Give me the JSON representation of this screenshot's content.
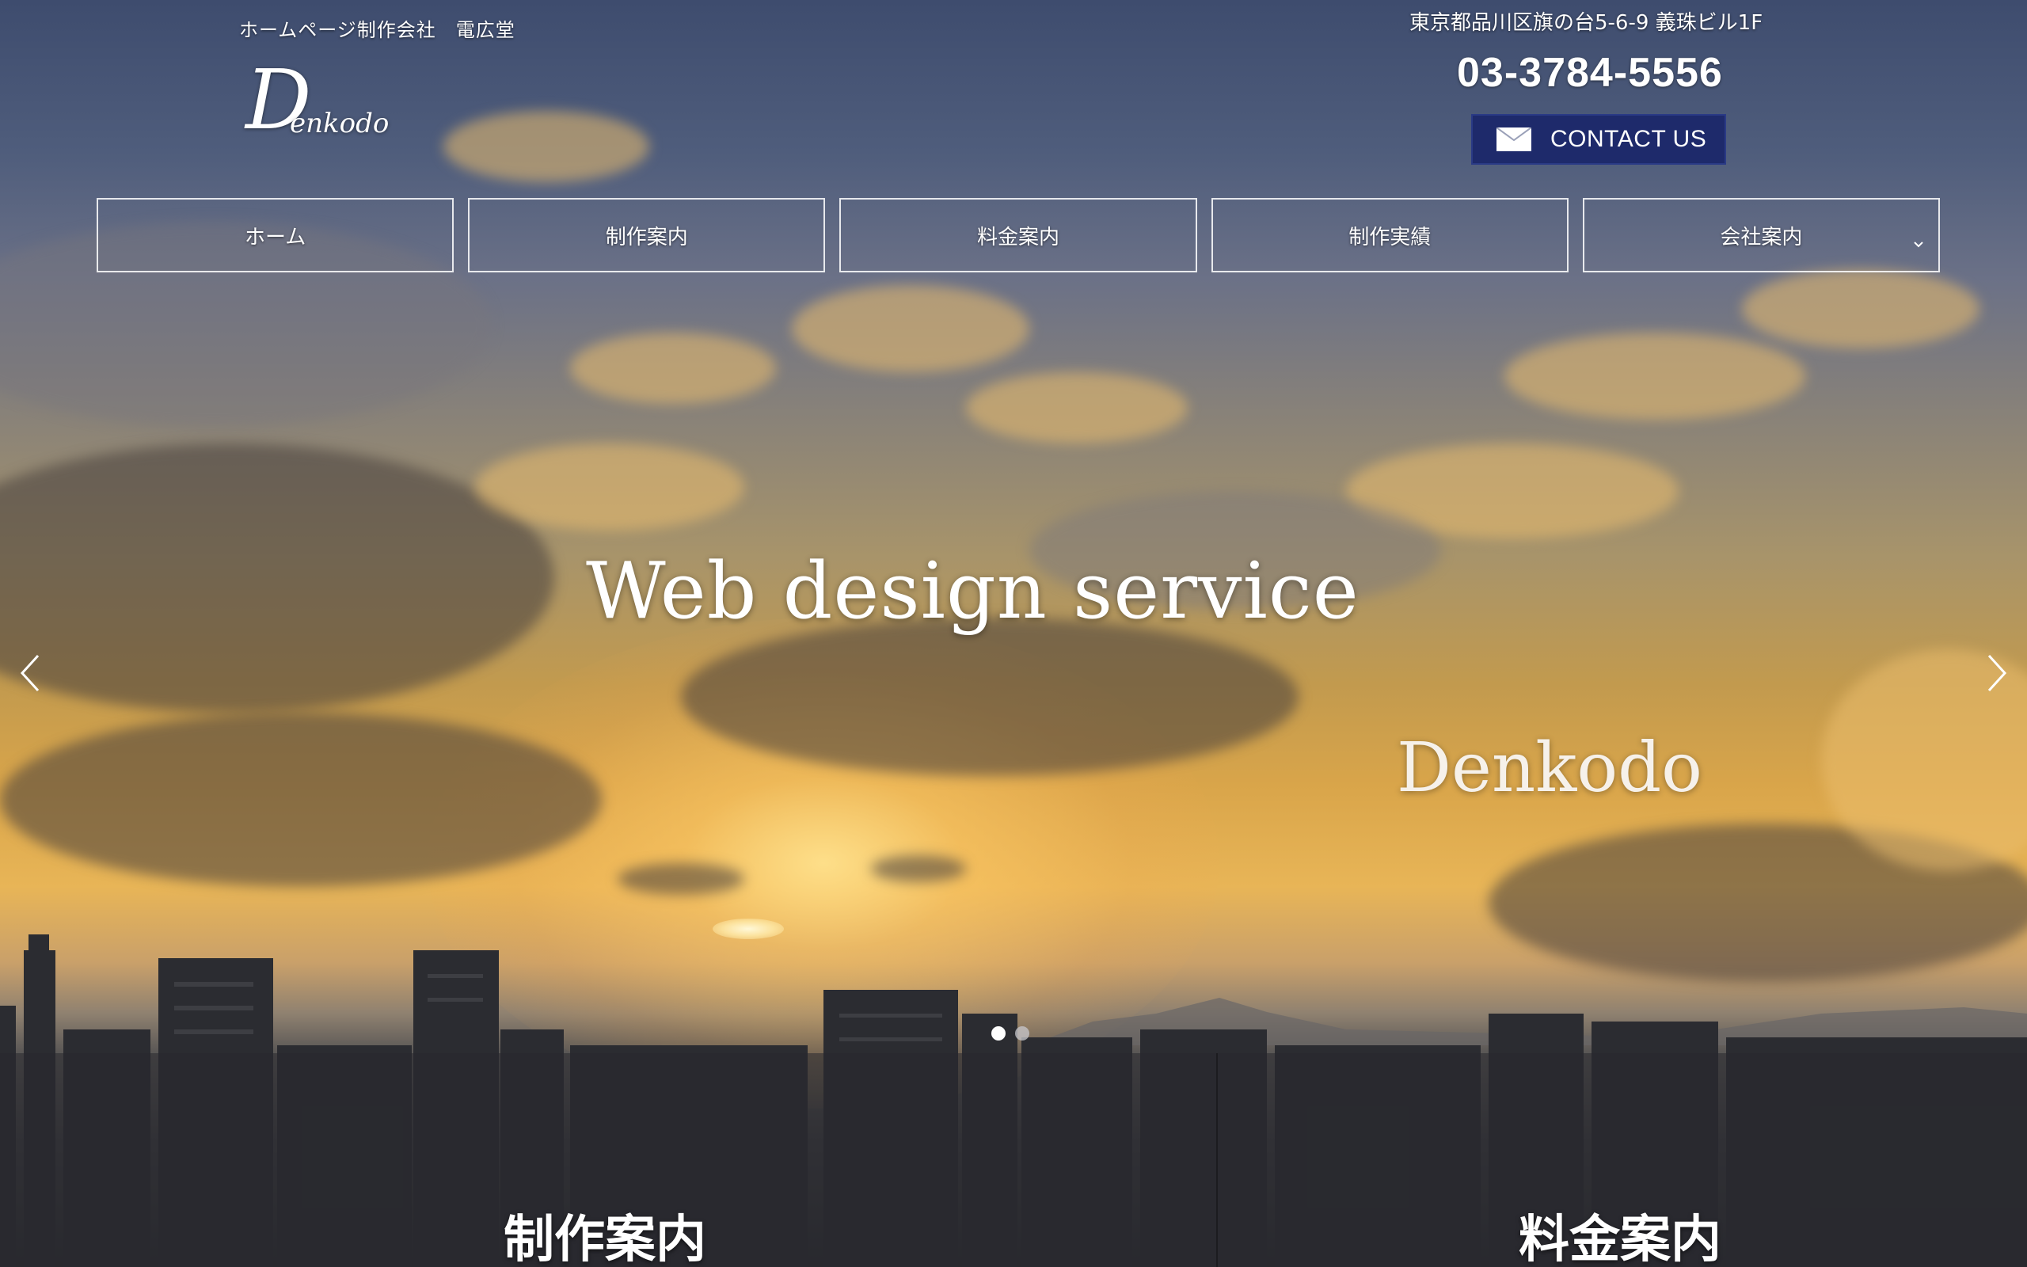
{
  "header": {
    "tagline": "ホームページ制作会社　電広堂",
    "logo_initial": "D",
    "logo_rest": "enkodo",
    "address": "東京都品川区旗の台5-6-9 義珠ビル1F",
    "phone": "03-3784-5556",
    "contact_label": "CONTACT US",
    "contact_icon": "mail-icon"
  },
  "nav": {
    "items": [
      {
        "label": "ホーム"
      },
      {
        "label": "制作案内"
      },
      {
        "label": "料金案内"
      },
      {
        "label": "制作実績"
      },
      {
        "label": "会社案内",
        "has_dropdown": true
      }
    ]
  },
  "hero": {
    "title": "Web design service",
    "subtitle": "Denkodo",
    "prev_icon": "chevron-left-icon",
    "next_icon": "chevron-right-icon",
    "slides_total": 2,
    "active_slide": 1
  },
  "panels": [
    {
      "title": "制作案内"
    },
    {
      "title": "料金案内"
    }
  ],
  "colors": {
    "contact_bg": "#1e2a6b",
    "nav_border": "#ffffff"
  }
}
